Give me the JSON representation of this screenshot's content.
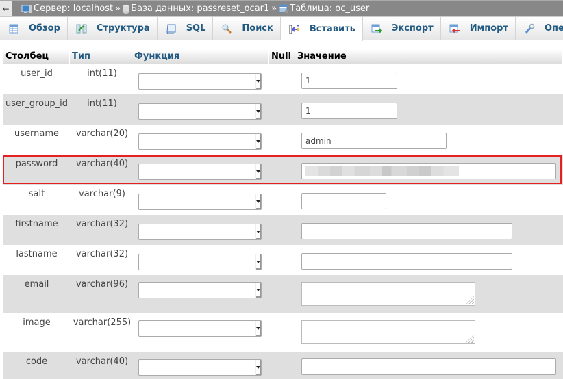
{
  "breadcrumb": {
    "back_label": "←",
    "items": [
      {
        "icon": "server-icon",
        "label": "Сервер: localhost"
      },
      {
        "icon": "database-icon",
        "label": "База данных: passreset_ocar1"
      },
      {
        "icon": "table-icon",
        "label": "Таблица: oc_user"
      }
    ],
    "separator": "»"
  },
  "tabs": [
    {
      "icon": "browse-icon",
      "label": "Обзор",
      "active": false
    },
    {
      "icon": "structure-icon",
      "label": "Структура",
      "active": false
    },
    {
      "icon": "sql-icon",
      "label": "SQL",
      "active": false
    },
    {
      "icon": "search-icon",
      "label": "Поиск",
      "active": false
    },
    {
      "icon": "insert-icon",
      "label": "Вставить",
      "active": true
    },
    {
      "icon": "export-icon",
      "label": "Экспорт",
      "active": false
    },
    {
      "icon": "import-icon",
      "label": "Импорт",
      "active": false
    },
    {
      "icon": "operations-icon",
      "label": "Операц",
      "active": false
    }
  ],
  "table": {
    "headers": {
      "column": "Столбец",
      "type": "Тип",
      "function": "Функция",
      "null": "Null",
      "value": "Значение"
    },
    "rows": [
      {
        "column": "user_id",
        "type": "int(11)",
        "function": "",
        "value": "1",
        "input": "text-short"
      },
      {
        "column": "user_group_id",
        "type": "int(11)",
        "function": "",
        "value": "1",
        "input": "text-short"
      },
      {
        "column": "username",
        "type": "varchar(20)",
        "function": "",
        "value": "admin",
        "input": "text-medium"
      },
      {
        "column": "password",
        "type": "varchar(40)",
        "function": "",
        "value": "[redacted]",
        "input": "text-long",
        "highlighted": true
      },
      {
        "column": "salt",
        "type": "varchar(9)",
        "function": "",
        "value": "",
        "input": "text-xshort"
      },
      {
        "column": "firstname",
        "type": "varchar(32)",
        "function": "",
        "value": "",
        "input": "text-wide"
      },
      {
        "column": "lastname",
        "type": "varchar(32)",
        "function": "",
        "value": "",
        "input": "text-wide"
      },
      {
        "column": "email",
        "type": "varchar(96)",
        "function": "",
        "value": "",
        "input": "textarea"
      },
      {
        "column": "image",
        "type": "varchar(255)",
        "function": "",
        "value": "",
        "input": "textarea"
      },
      {
        "column": "code",
        "type": "varchar(40)",
        "function": "",
        "value": "",
        "input": "text-long"
      }
    ]
  },
  "colors": {
    "highlight": "#e52020",
    "tab_text": "#235a81",
    "row_alt": "#dfdfdf",
    "topbar": "#888888"
  }
}
